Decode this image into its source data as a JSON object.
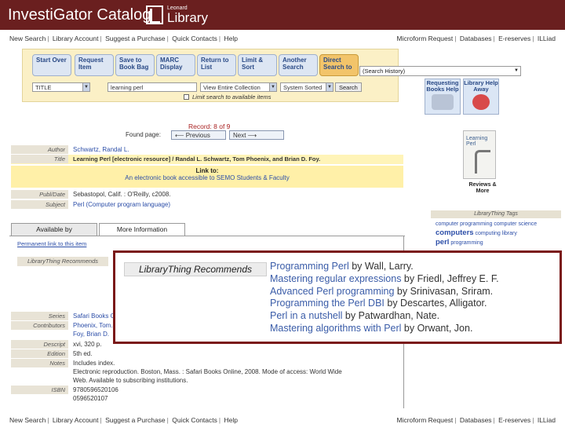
{
  "header": {
    "title": "InvestiGator Catalog",
    "logo_small": "Leonard",
    "logo_big": "Library"
  },
  "nav": {
    "left_items": [
      "New Search",
      "Library Account",
      "Suggest a Purchase",
      "Quick Contacts",
      "Help"
    ],
    "right_items": [
      "Microform Request",
      "Databases",
      "E-reserves",
      "ILLiad"
    ]
  },
  "toolbar": {
    "buttons": [
      {
        "label": "Start Over"
      },
      {
        "label": "Request Item"
      },
      {
        "label": "Save to Book Bag"
      },
      {
        "label": "MARC Display"
      },
      {
        "label": "Return to List"
      },
      {
        "label": "Limit & Sort"
      },
      {
        "label": "Another Search"
      },
      {
        "label": "Direct Search to"
      }
    ],
    "search_type": "TITLE",
    "search_term": "learning perl",
    "collection": "View Entire Collection",
    "sort": "System Sorted",
    "search_button": "Search",
    "limit_text": "Limit search to available items",
    "direct_dropdown": "(Search History)"
  },
  "help_buttons": [
    {
      "label": "Requesting Books Help"
    },
    {
      "label": "Library Help Away"
    }
  ],
  "record_nav": {
    "record_label": "Record: 8 of 9",
    "found_page": "Found page:",
    "prev": "Previous",
    "next": "Next"
  },
  "record": {
    "author_label": "Author",
    "author": "Schwartz, Randal L.",
    "title_label": "Title",
    "title": "Learning Perl [electronic resource] / Randal L. Schwartz, Tom Phoenix, and Brian D. Foy.",
    "link_heading": "Link to:",
    "link_text": "An electronic book accessible to SEMO Students & Faculty",
    "pubdate_label": "Publ/Date",
    "pubdate": "Sebastopol, Calif. : O'Reilly, c2008.",
    "subject_label": "Subject",
    "subject": "Perl (Computer program language)"
  },
  "cover": {
    "title": "Learning Perl",
    "reviews": "Reviews & More"
  },
  "librarything_tags": {
    "heading": "LibraryThing Tags",
    "tags": [
      "computer programming",
      "computer science",
      "computers",
      "computing",
      "library",
      "perl",
      "programming"
    ]
  },
  "tabs": {
    "available": "Available by",
    "more_info": "More Information"
  },
  "permalink": "Permanent link to this item",
  "ltr_label": "LibraryThing Recommends",
  "recommendations_popup": {
    "heading": "LibraryThing Recommends",
    "items": [
      {
        "title": "Programming Perl",
        "rest": " by Wall, Larry."
      },
      {
        "title": "Mastering regular expressions",
        "rest": " by Friedl, Jeffrey E. F."
      },
      {
        "title": "Advanced Perl programming",
        "rest": " by Srinivasan, Sriram."
      },
      {
        "title": "Programming the Perl DBI",
        "rest": " by Descartes, Alligator."
      },
      {
        "title": "Perl in a nutshell",
        "rest": " by Patwardhan, Nate."
      },
      {
        "title": "Mastering algorithms with Perl",
        "rest": " by Orwant, Jon."
      }
    ]
  },
  "details": {
    "series_label": "Series",
    "series": "Safari Books Online",
    "contributors_label": "Contributors",
    "contributors": "Phoenix, Tom.",
    "contributors_2": "Foy, Brian D.",
    "descript_label": "Descript",
    "descript": "xvi, 320 p.",
    "edition_label": "Edition",
    "edition": "5th ed.",
    "notes_label": "Notes",
    "notes": "Includes index.",
    "notes_2": "Electronic reproduction. Boston, Mass. : Safari Books Online, 2008. Mode of access: World Wide",
    "notes_3": "Web. Available to subscribing institutions.",
    "isbn_label": "ISBN",
    "isbn": "9780596520106",
    "isbn_2": "0596520107"
  }
}
